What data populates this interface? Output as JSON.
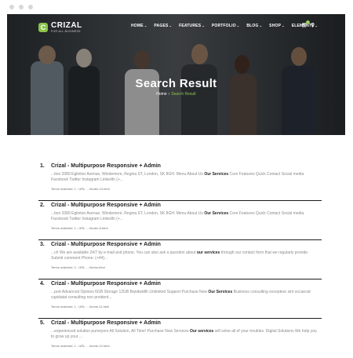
{
  "brand": {
    "name": "CRIZAL",
    "tagline": "FOR ALL BUSINESS",
    "accent": "#8bc34a"
  },
  "nav": {
    "items": [
      {
        "label": "HOME"
      },
      {
        "label": "PAGES"
      },
      {
        "label": "FEATURES"
      },
      {
        "label": "PORTFOLIO"
      },
      {
        "label": "BLOG"
      },
      {
        "label": "SHOP"
      },
      {
        "label": "ELEMENTS"
      }
    ],
    "cart_count": "0",
    "cart_icon": "cart-icon",
    "search_icon": "search-icon"
  },
  "hero": {
    "title": "Search Result",
    "breadcrumb": {
      "home": "Home",
      "current": "Search Result"
    }
  },
  "results": [
    {
      "num": "1.",
      "title": "Crizal - Multipurpose Responsive + Admin",
      "snippet_pre": "...tion 3389 Eglinton Avenue, Windemere, Regina ST, London, SK 8GH. Menu About Us ",
      "snippet_bold": "Our Services",
      "snippet_post": " Core Features Quick Contact Social media Facebook Twitter Instagram LinkedIn (+...",
      "terms": "Terms matched: 1 - URL: .../footer-13.html"
    },
    {
      "num": "2.",
      "title": "Crizal - Multipurpose Responsive + Admin",
      "snippet_pre": "...tion 3389 Eglinton Avenue, Windemere, Regina ST, London, SK 8GH. Menu About Us ",
      "snippet_bold": "Our Services",
      "snippet_post": " Core Features Quick Contact Social media Facebook Twitter Instagram LinkedIn (+...",
      "terms": "Terms matched: 1 - URL: .../footer-8.html"
    },
    {
      "num": "3.",
      "title": "Crizal - Multipurpose Responsive + Admin",
      "snippet_pre": "...ch We are available 24/7 by e-mail and phone. You can also ask a question about ",
      "snippet_bold": "our services",
      "snippet_post": " through our contact form that we regularly provide. Submit comment Phone: (+44)...",
      "terms": "Terms matched: 2 - URL: .../forms.html"
    },
    {
      "num": "4.",
      "title": "Crizal - Multipurpose Responsive + Admin",
      "snippet_pre": "...port Advanced Options 6GB Storage 12GB Bandwidth Unlimited Support Purchase Now ",
      "snippet_bold": "Our Services",
      "snippet_post": " Business consulting excepteur sint occaecat cupidatat consulting non proident...",
      "terms": "Terms matched: 1 - URL: .../home-11.html"
    },
    {
      "num": "5.",
      "title": "Crizal - Multipurpose Responsive + Admin",
      "snippet_pre": "...experienced solution purveyors All Solution, All Time! Purchase Now Services ",
      "snippet_bold": "Our services",
      "snippet_post": " will solve all of your troubles. Digital Solutions We help you to grow up your ...",
      "terms": "Terms matched: 1 - URL: .../home-12.html"
    }
  ]
}
